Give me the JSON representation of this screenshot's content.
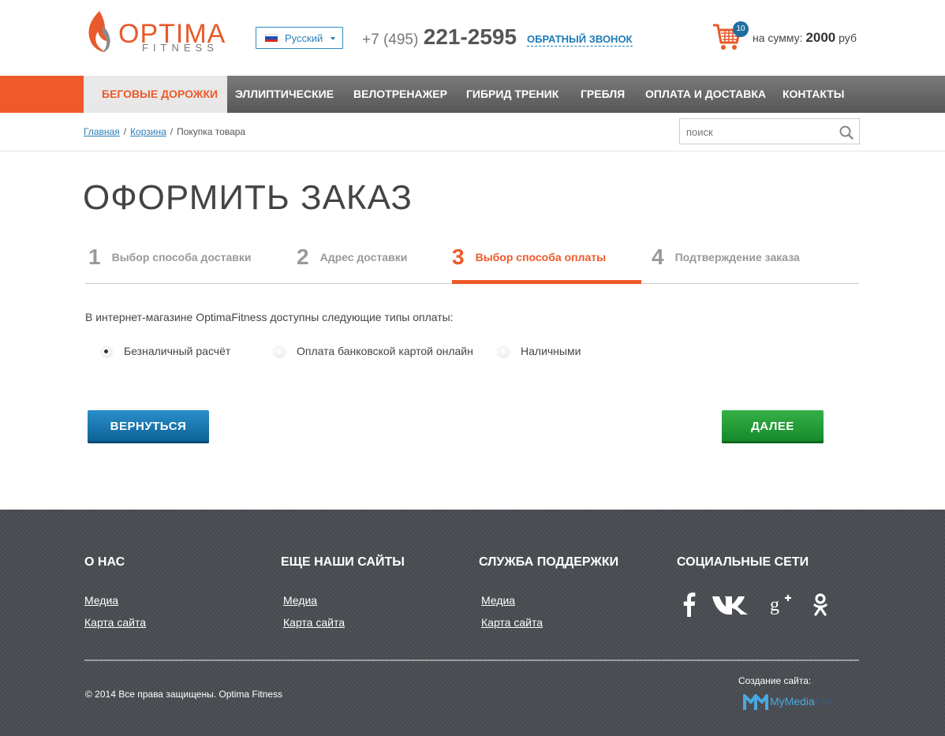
{
  "header": {
    "logo": {
      "main": "OPTIMA",
      "sub": "FITNESS"
    },
    "language": {
      "label": "Русский",
      "flag": "russia"
    },
    "phone": {
      "code": "+7 (495)",
      "number": "221-2595"
    },
    "callback_label": "ОБРАТНЫЙ ЗВОНОК",
    "cart": {
      "count": "10",
      "sum_label": "на сумму:",
      "sum_value": "2000",
      "currency": "руб"
    }
  },
  "nav": {
    "items": [
      {
        "label": "БЕГОВЫЕ ДОРОЖКИ",
        "active": true
      },
      {
        "label": "ЭЛЛИПТИЧЕСКИЕ"
      },
      {
        "label": "ВЕЛОТРЕНАЖЕР"
      },
      {
        "label": "ГИБРИД ТРЕНИК"
      },
      {
        "label": "ГРЕБЛЯ"
      },
      {
        "label": "ОПЛАТА И ДОСТАВКА"
      },
      {
        "label": "КОНТАКТЫ"
      }
    ]
  },
  "breadcrumb": [
    "Главная",
    "Корзина",
    "Покупка товара"
  ],
  "search": {
    "placeholder": "поиск"
  },
  "page_title": "ОФОРМИТЬ ЗАКАЗ",
  "steps": [
    {
      "number": "1",
      "label": "Выбор способа доставки"
    },
    {
      "number": "2",
      "label": "Адрес доставки"
    },
    {
      "number": "3",
      "label": "Выбор способа оплаты",
      "active": true
    },
    {
      "number": "4",
      "label": "Подтверждение заказа"
    }
  ],
  "payment": {
    "intro": "В интернет-магазине OptimaFitness доступны следующие типы оплаты:",
    "options": [
      {
        "label": "Безналичный расчёт",
        "checked": true
      },
      {
        "label": "Оплата банковской картой онлайн",
        "checked": false
      },
      {
        "label": "Наличными",
        "checked": false
      }
    ]
  },
  "buttons": {
    "back": "ВЕРНУТЬСЯ",
    "next": "ДАЛЕЕ"
  },
  "colors": {
    "accent": "#ef5a2a",
    "link": "#2c7fb8",
    "back": "#1a78b3",
    "next": "#2a9e3c",
    "footer": "#4a4d52"
  },
  "footer": {
    "columns": [
      {
        "title": "О НАС",
        "links": [
          "Медиа",
          "Карта сайта"
        ]
      },
      {
        "title": "ЕЩЕ НАШИ САЙТЫ",
        "links": [
          "Медиа",
          "Карта сайта"
        ]
      },
      {
        "title": "СЛУЖБА ПОДДЕРЖКИ",
        "links": [
          "Медиа",
          "Карта сайта"
        ]
      },
      {
        "title": "СОЦИАЛЬНЫЕ СЕТИ",
        "icons": [
          "facebook-icon",
          "vk-icon",
          "google-plus-icon",
          "odnoklassniki-icon"
        ]
      }
    ],
    "copyright": "© 2014 Все права защищены. Optima Fitness",
    "made_by_label": "Создание сайта:",
    "made_by_logo": {
      "name": "MyMedia",
      "suffix": "Pro"
    }
  }
}
